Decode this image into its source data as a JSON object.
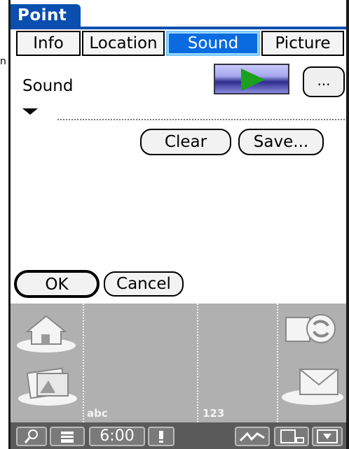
{
  "app": {
    "title": "Point"
  },
  "tabs": [
    {
      "label": "Info",
      "active": false
    },
    {
      "label": "Location",
      "active": false
    },
    {
      "label": "Sound",
      "active": true
    },
    {
      "label": "Picture",
      "active": false
    }
  ],
  "stray_text": "n",
  "sound": {
    "label": "Sound",
    "more_label": "...",
    "clear_label": "Clear",
    "save_label": "Save..."
  },
  "dialog": {
    "ok_label": "OK",
    "cancel_label": "Cancel"
  },
  "launcher": {
    "left_column_icons": [
      "home-icon",
      "photo-album-icon"
    ],
    "right_column_icons": [
      "sync-icon",
      "mail-icon"
    ],
    "abc_label": "abc",
    "num_label": "123"
  },
  "statusbar": {
    "time": "6:00",
    "icons": [
      "find-icon",
      "menu-icon",
      "alert-icon",
      "graffiti-icon",
      "input-toggle-icon",
      "hide-icon"
    ]
  },
  "colors": {
    "accent": "#0a4fb0",
    "active_tab": "#0a6be0",
    "play_green": "#1aa01a",
    "launcher_bg": "#b0b0b0"
  }
}
